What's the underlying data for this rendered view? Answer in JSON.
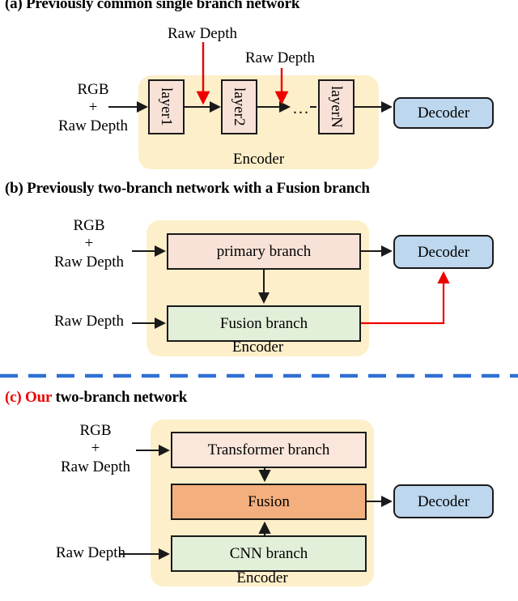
{
  "figure": {
    "background": "#ffffff",
    "palette": {
      "encoder_panel": "#FDEFC9",
      "pink_branch": "#F8E2D7",
      "pink_light": "#FAE6DB",
      "green_branch": "#E2EFD9",
      "orange_fusion": "#F3AF7E",
      "decoder_blue": "#BDD7EE",
      "red_accent": "#EE0000",
      "divider_blue": "#2E6FD4",
      "arrow_black": "#1a1a1a"
    }
  },
  "panels": [
    {
      "id": "a",
      "caption_prefix": "(a)",
      "caption_text": " Previously common single branch network",
      "input_label_lines": [
        "RGB",
        "+",
        "Raw Depth"
      ],
      "encoder_label": "Encoder",
      "red_annotations": [
        "Raw Depth",
        "Raw Depth"
      ],
      "ellipsis": "...",
      "nodes": [
        {
          "name": "layer1",
          "label": "layer1",
          "color": "pink"
        },
        {
          "name": "layer2",
          "label": "layer2",
          "color": "pink"
        },
        {
          "name": "layerN",
          "label": "layerN",
          "color": "pink"
        },
        {
          "name": "decoder",
          "label": "Decoder",
          "color": "blue"
        }
      ]
    },
    {
      "id": "b",
      "caption_prefix": "(b)",
      "caption_text": " Previously two-branch network with a Fusion branch",
      "input_label_lines": [
        "RGB",
        "+",
        "Raw Depth"
      ],
      "input_label_2": "Raw Depth",
      "encoder_label": "Encoder",
      "nodes": [
        {
          "name": "primary-branch",
          "label": "primary branch",
          "color": "pink"
        },
        {
          "name": "fusion-branch",
          "label": "Fusion branch",
          "color": "green"
        },
        {
          "name": "decoder",
          "label": "Decoder",
          "color": "blue"
        }
      ]
    },
    {
      "id": "c",
      "caption_prefix": "(c)",
      "caption_prefix_highlight": " Our",
      "caption_text": " two-branch network",
      "input_label_lines": [
        "RGB",
        "+",
        "Raw Depth"
      ],
      "input_label_2": "Raw Depth",
      "encoder_label": "Encoder",
      "nodes": [
        {
          "name": "transformer-branch",
          "label": "Transformer branch",
          "color": "pink2"
        },
        {
          "name": "fusion",
          "label": "Fusion",
          "color": "orange"
        },
        {
          "name": "cnn-branch",
          "label": "CNN branch",
          "color": "green"
        },
        {
          "name": "decoder",
          "label": "Decoder",
          "color": "blue"
        }
      ]
    }
  ]
}
